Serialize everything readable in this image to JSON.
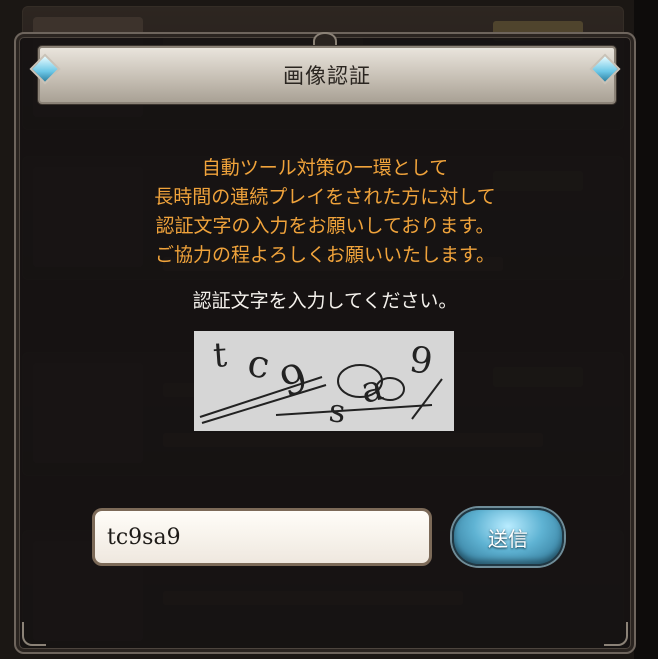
{
  "dialog": {
    "title": "画像認証",
    "message_lines": [
      "自動ツール対策の一環として",
      "長時間の連続プレイをされた方に対して",
      "認証文字の入力をお願いしております。",
      "ご協力の程よろしくお願いいたします。"
    ],
    "instruction": "認証文字を入力してください。",
    "captcha_text": "tc9sa9",
    "input_value": "tc9sa9",
    "send_label": "送信"
  },
  "colors": {
    "message_text": "#f0a33b",
    "instruction_text": "#f4f1ec",
    "send_button": "#5fb3d3",
    "title_bar": "#d8d2c8"
  },
  "icons": [
    "diamond-gem-icon-left",
    "diamond-gem-icon-right",
    "title-crest-icon"
  ]
}
